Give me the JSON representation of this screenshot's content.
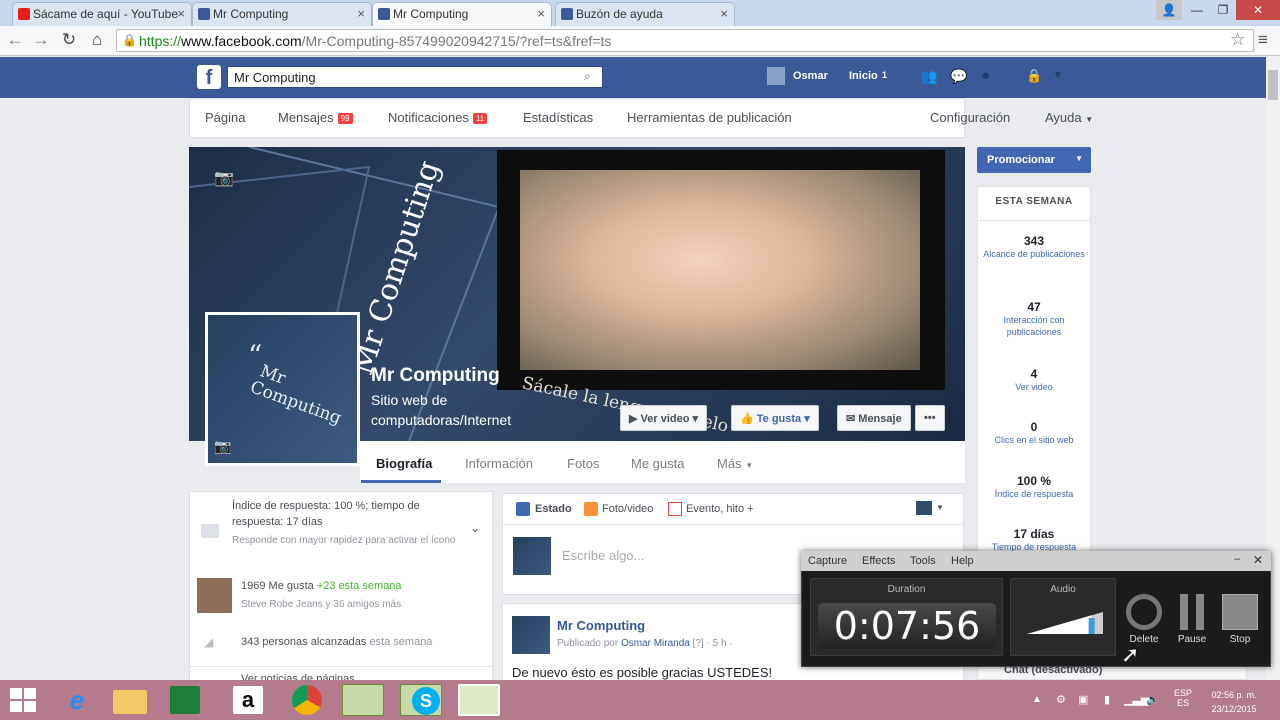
{
  "browser": {
    "tabs": [
      {
        "title": "Sácame de aquí - YouTube",
        "icon": "youtube-icon"
      },
      {
        "title": "Mr Computing",
        "icon": "facebook-icon"
      },
      {
        "title": "Mr Computing",
        "icon": "facebook-icon",
        "active": true
      },
      {
        "title": "Buzón de ayuda",
        "icon": "facebook-icon"
      }
    ],
    "url_scheme": "https://",
    "url_domain": "www.facebook.com",
    "url_path": "/Mr-Computing-857499020942715/?ref=ts&fref=ts"
  },
  "fb": {
    "logo": "f",
    "search_value": "Mr Computing",
    "user_name": "Osmar",
    "home_label": "Inicio",
    "home_count": "1"
  },
  "pagenav": {
    "pagina": "Página",
    "mensajes": "Mensajes",
    "mensajes_badge": "99",
    "notificaciones": "Notificaciones",
    "notificaciones_badge": "11",
    "estadisticas": "Estadísticas",
    "herramientas": "Herramientas de publicación",
    "configuracion": "Configuración",
    "ayuda": "Ayuda"
  },
  "cover": {
    "cover_text": "Mr Computing",
    "cover_slogan": "Sácale la lengua al hielo",
    "page_name": "Mr Computing",
    "category_line1": "Sitio web de",
    "category_line2": "computadoras/Internet",
    "avatar_quote": "“",
    "avatar_line1": "Mr",
    "avatar_line2": "Computing",
    "btn_video": "Ver video",
    "btn_like": "Te gusta",
    "btn_message": "Mensaje",
    "btn_more": "•••"
  },
  "pagetabs": [
    "Biografía",
    "Información",
    "Fotos",
    "Me gusta",
    "Más"
  ],
  "promo": "Promocionar",
  "week": {
    "header": "ESTA SEMANA",
    "stats": [
      {
        "value": "343",
        "label": "Alcance de publicaciones"
      },
      {
        "value": "47",
        "label": "Interacción con publicaciones"
      },
      {
        "value": "4",
        "label": "Ver video"
      },
      {
        "value": "0",
        "label": "Clics en el sitio web"
      },
      {
        "value": "100 %",
        "label": "Índice de respuesta"
      },
      {
        "value": "17 días",
        "label": "Tiempo de respuesta"
      }
    ]
  },
  "info": {
    "response": "Índice de respuesta: 100 %; tiempo de respuesta: 17 días",
    "response_hint": "Responde con mayor rapidez para activar el ícono",
    "likes": "1969 Me gusta",
    "likes_week": "+23 esta semana",
    "likes_friends": "Steve Robe Jeans y 36 amigos más",
    "reach": "343 personas alcanzadas",
    "reach_week": "esta semana",
    "news": "Ver noticias de páginas"
  },
  "composer": {
    "estado": "Estado",
    "foto": "Foto/video",
    "evento": "Evento, hito +",
    "placeholder": "Escribe algo..."
  },
  "post": {
    "author": "Mr Computing",
    "meta_prefix": "Publicado por",
    "meta_name": "Osmar Miranda",
    "meta_time": "[?] · 5 h ·",
    "text": "De nuevo ésto es posible gracias USTEDES!"
  },
  "chat": "Chat (desactivado)",
  "recorder": {
    "menu": [
      "Capture",
      "Effects",
      "Tools",
      "Help"
    ],
    "duration_label": "Duration",
    "duration": "0:07:56",
    "audio_label": "Audio",
    "audio_level": 0.85,
    "delete": "Delete",
    "pause": "Pause",
    "stop": "Stop"
  },
  "taskbar": {
    "lang1": "ESP",
    "lang2": "ES",
    "time": "02:56 p. m.",
    "date": "23/12/2015"
  }
}
